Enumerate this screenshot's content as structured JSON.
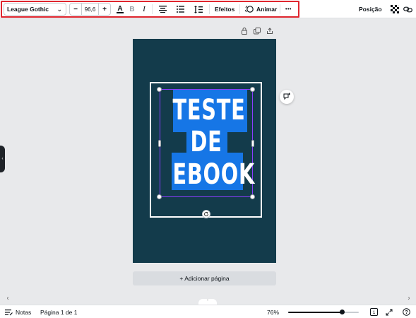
{
  "toolbar": {
    "font_name": "League Gothic",
    "font_size": "96,6",
    "decrease_label": "−",
    "increase_label": "+",
    "text_color_glyph": "A",
    "bold_glyph": "B",
    "italic_glyph": "I",
    "effects_label": "Efeitos",
    "animate_label": "Animar",
    "more_glyph": "•••",
    "position_label": "Posição",
    "highlight_color": "#e0262f"
  },
  "canvas": {
    "page_color": "#133b4b",
    "text_highlight_color": "#1676e6",
    "text_lines": [
      "TESTE",
      "DE",
      "EBOOK"
    ],
    "add_page_label": "+ Adicionar página",
    "selection_color": "#8b3dff"
  },
  "bottombar": {
    "notes_label": "Notas",
    "page_indicator": "Página 1 de 1",
    "zoom_level": "76%",
    "zoom_fraction": 0.76,
    "pages_count": "1",
    "help_glyph": "?"
  },
  "icons": {
    "lock": "lock-icon",
    "duplicate": "duplicate-icon",
    "share": "share-icon",
    "transparency": "transparency-icon",
    "link": "link-icon",
    "notes": "notes-icon",
    "fullscreen": "fullscreen-icon",
    "help": "help-icon"
  }
}
